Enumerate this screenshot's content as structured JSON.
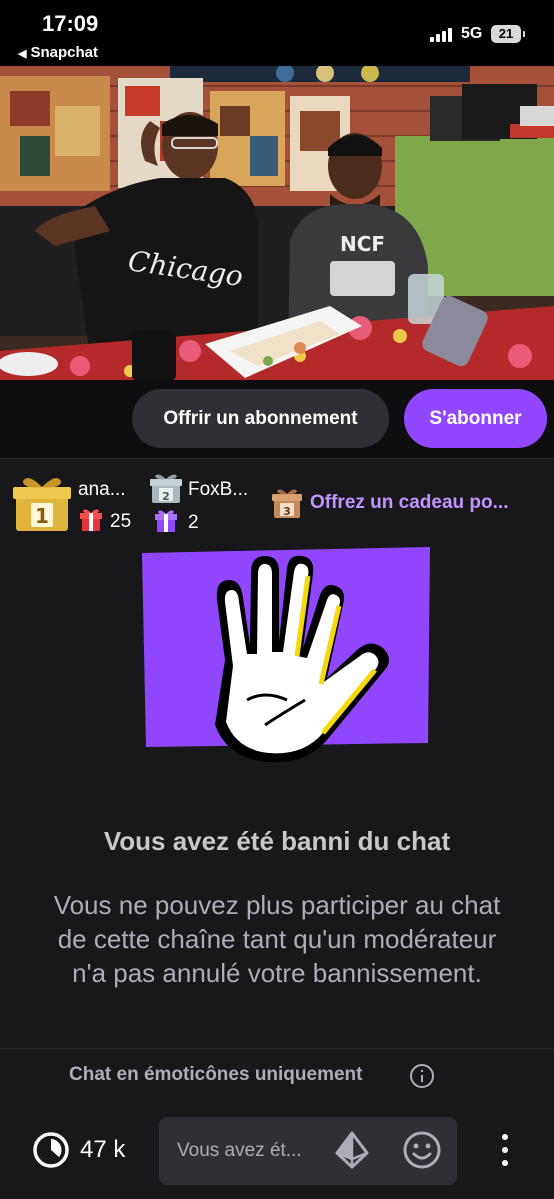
{
  "status_bar": {
    "time": "17:09",
    "back_app": "Snapchat",
    "network": "5G",
    "battery": "21"
  },
  "video": {
    "shirt_text": "Chicago",
    "shirt_text_2": "NCF"
  },
  "actions": {
    "gift_sub_label": "Offrir un abonnement",
    "subscribe_label": "S'abonner"
  },
  "leaderboard": {
    "entries": [
      {
        "rank": "1",
        "name": "ana...",
        "count": "25"
      },
      {
        "rank": "2",
        "name": "FoxB...",
        "count": "2"
      }
    ],
    "third_rank": "3",
    "gift_cta": "Offrez un cadeau po..."
  },
  "ban": {
    "title": "Vous avez été banni du chat",
    "description": "Vous ne pouvez plus participer au chat de cette chaîne tant qu'un modérateur n'a pas annulé votre bannissement."
  },
  "chat_mode": {
    "label": "Chat en émoticônes uniquement"
  },
  "footer": {
    "viewer_count": "47 k",
    "input_placeholder": "Vous avez ét..."
  },
  "colors": {
    "accent": "#9147ff",
    "accent_text": "#bf94ff",
    "background": "#18181b",
    "button_dark": "#2f2f35"
  }
}
